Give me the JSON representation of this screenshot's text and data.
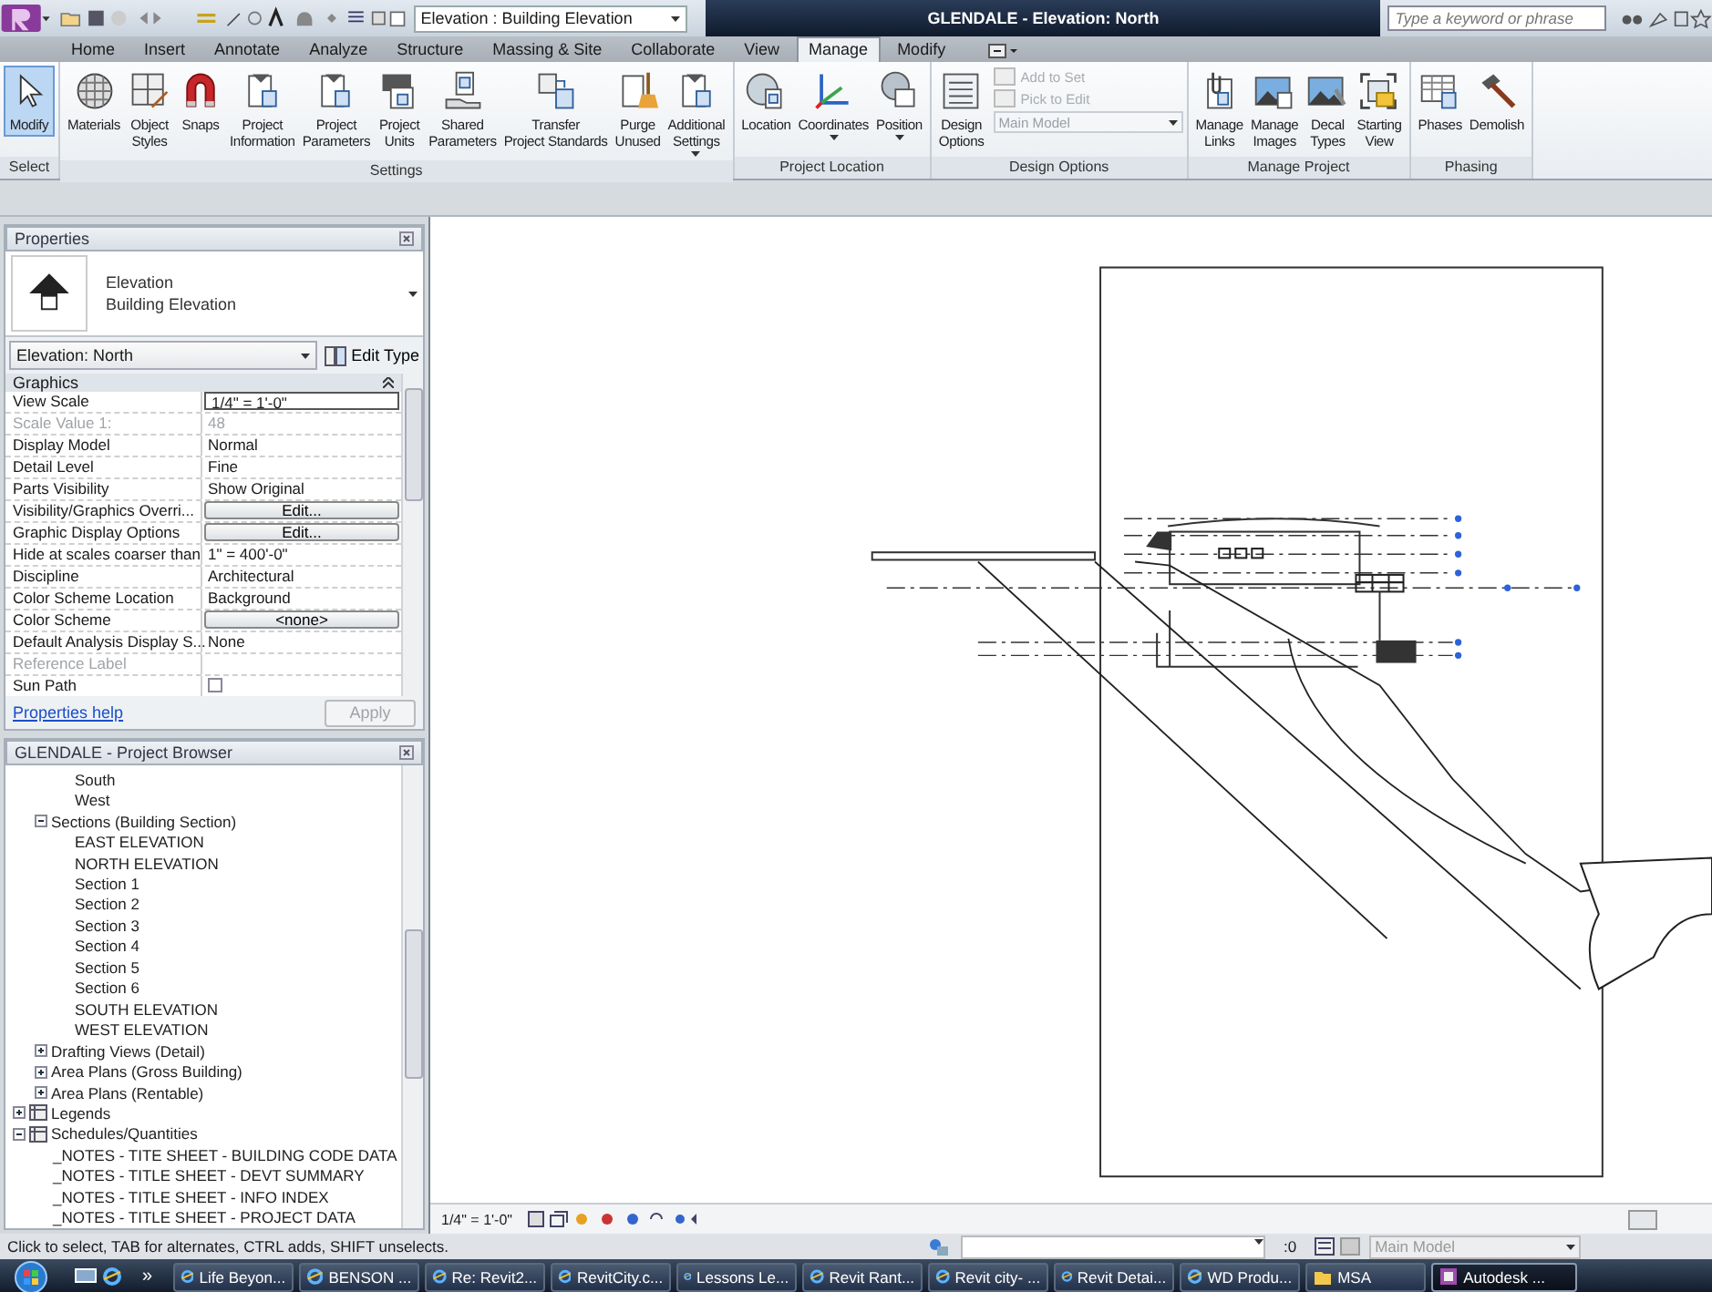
{
  "title_bar": {
    "view_selector": "Elevation : Building Elevation",
    "title": "GLENDALE - Elevation: North",
    "search": {
      "placeholder": "Type a keyword or phrase"
    }
  },
  "tabs": [
    {
      "label": "Home",
      "selected": false
    },
    {
      "label": "Insert",
      "selected": false
    },
    {
      "label": "Annotate",
      "selected": false
    },
    {
      "label": "Analyze",
      "selected": false
    },
    {
      "label": "Structure",
      "selected": false
    },
    {
      "label": "Massing & Site",
      "selected": false
    },
    {
      "label": "Collaborate",
      "selected": false
    },
    {
      "label": "View",
      "selected": false
    },
    {
      "label": "Manage",
      "selected": true
    },
    {
      "label": "Modify",
      "selected": false
    }
  ],
  "ribbon": {
    "panels": [
      {
        "title": "Select",
        "buttons": [
          {
            "kind": "cursor",
            "label": "Modify",
            "selected": true,
            "dropdown": false
          }
        ]
      },
      {
        "title": "Settings",
        "buttons": [
          {
            "kind": "sphere",
            "label": "Materials",
            "selected": false,
            "dropdown": false
          },
          {
            "kind": "styles",
            "label": "Object\nStyles",
            "selected": false,
            "dropdown": false
          },
          {
            "kind": "magnet",
            "label": "Snaps",
            "selected": false,
            "dropdown": false
          },
          {
            "kind": "doc",
            "label": "Project\nInformation",
            "selected": false,
            "dropdown": false
          },
          {
            "kind": "doc",
            "label": "Project\nParameters",
            "selected": false,
            "dropdown": false
          },
          {
            "kind": "units",
            "label": "Project\nUnits",
            "selected": false,
            "dropdown": false
          },
          {
            "kind": "shared",
            "label": "Shared\nParameters",
            "selected": false,
            "dropdown": false
          },
          {
            "kind": "transfer",
            "label": "Transfer\nProject Standards",
            "selected": false,
            "dropdown": false
          },
          {
            "kind": "purge",
            "label": "Purge\nUnused",
            "selected": false,
            "dropdown": false
          },
          {
            "kind": "doc",
            "label": "Additional\nSettings",
            "selected": false,
            "dropdown": true
          }
        ]
      },
      {
        "title": "Project Location",
        "buttons": [
          {
            "kind": "globe",
            "label": "Location",
            "selected": false,
            "dropdown": false
          },
          {
            "kind": "axes",
            "label": "Coordinates",
            "selected": false,
            "dropdown": true
          },
          {
            "kind": "position",
            "label": "Position",
            "selected": false,
            "dropdown": true
          }
        ]
      },
      {
        "title": "Design Options",
        "buttons": [
          {
            "kind": "list",
            "label": "Design\nOptions",
            "selected": false,
            "dropdown": false
          }
        ],
        "tools": [
          {
            "label": "Add to Set",
            "disabled": true
          },
          {
            "label": "Pick to Edit",
            "disabled": true
          }
        ],
        "selector": {
          "value": "Main Model",
          "disabled": true
        }
      },
      {
        "title": "Manage Project",
        "buttons": [
          {
            "kind": "links",
            "label": "Manage\nLinks",
            "selected": false,
            "dropdown": false
          },
          {
            "kind": "image",
            "label": "Manage\nImages",
            "selected": false,
            "dropdown": false
          },
          {
            "kind": "decal",
            "label": "Decal\nTypes",
            "selected": false,
            "dropdown": false
          },
          {
            "kind": "view",
            "label": "Starting\nView",
            "selected": false,
            "dropdown": false
          }
        ]
      },
      {
        "title": "Phasing",
        "buttons": [
          {
            "kind": "table",
            "label": "Phases",
            "selected": false,
            "dropdown": false
          },
          {
            "kind": "hammer",
            "label": "Demolish",
            "selected": false,
            "dropdown": false
          }
        ]
      }
    ]
  },
  "properties": {
    "title": "Properties",
    "type_name": "Elevation",
    "type_family": "Building Elevation",
    "instance_selector": "Elevation: North",
    "edit_type": "Edit Type",
    "group": "Graphics",
    "rows": [
      {
        "name": "View Scale",
        "value": "1/4\" = 1'-0\"",
        "kind": "field",
        "disabled": false
      },
      {
        "name": "Scale Value    1:",
        "value": "48",
        "kind": "text",
        "disabled": true
      },
      {
        "name": "Display Model",
        "value": "Normal",
        "kind": "text",
        "disabled": false
      },
      {
        "name": "Detail Level",
        "value": "Fine",
        "kind": "text",
        "disabled": false
      },
      {
        "name": "Parts Visibility",
        "value": "Show Original",
        "kind": "text",
        "disabled": false
      },
      {
        "name": "Visibility/Graphics Overri...",
        "value": "Edit...",
        "kind": "button",
        "disabled": false
      },
      {
        "name": "Graphic Display Options",
        "value": "Edit...",
        "kind": "button",
        "disabled": false
      },
      {
        "name": "Hide at scales coarser than",
        "value": "1\" = 400'-0\"",
        "kind": "text",
        "disabled": false
      },
      {
        "name": "Discipline",
        "value": "Architectural",
        "kind": "text",
        "disabled": false
      },
      {
        "name": "Color Scheme Location",
        "value": "Background",
        "kind": "text",
        "disabled": false
      },
      {
        "name": "Color Scheme",
        "value": "<none>",
        "kind": "button",
        "disabled": false
      },
      {
        "name": "Default Analysis Display S...",
        "value": "None",
        "kind": "text",
        "disabled": false
      },
      {
        "name": "Reference Label",
        "value": "",
        "kind": "text",
        "disabled": true
      },
      {
        "name": "Sun Path",
        "value": "",
        "kind": "checkbox",
        "disabled": false
      }
    ],
    "help_link": "Properties help",
    "apply": "Apply"
  },
  "browser": {
    "title": "GLENDALE - Project Browser",
    "tree": [
      {
        "children": [
          {
            "children": [
              {
                "label": "South"
              },
              {
                "label": "West"
              }
            ]
          },
          {
            "label": "Sections (Building Section)",
            "expanded": true,
            "children": [
              {
                "label": "EAST ELEVATION"
              },
              {
                "label": "NORTH ELEVATION"
              },
              {
                "label": "Section 1"
              },
              {
                "label": "Section 2"
              },
              {
                "label": "Section 3"
              },
              {
                "label": "Section 4"
              },
              {
                "label": "Section 5"
              },
              {
                "label": "Section 6"
              },
              {
                "label": "SOUTH ELEVATION"
              },
              {
                "label": "WEST ELEVATION"
              }
            ]
          },
          {
            "label": "Drafting Views (Detail)",
            "expanded": false
          },
          {
            "label": "Area Plans (Gross Building)",
            "expanded": false
          },
          {
            "label": "Area Plans (Rentable)",
            "expanded": false
          }
        ]
      },
      {
        "label": "Legends",
        "expanded": false,
        "kind": "category"
      },
      {
        "label": "Schedules/Quantities",
        "expanded": true,
        "kind": "category",
        "children": [
          {
            "label": "_NOTES - TITE SHEET - BUILDING CODE DATA"
          },
          {
            "label": "_NOTES - TITLE SHEET - DEVT SUMMARY"
          },
          {
            "label": "_NOTES - TITLE SHEET - INFO INDEX"
          },
          {
            "label": "_NOTES - TITLE SHEET - PROJECT DATA"
          }
        ]
      }
    ]
  },
  "view_bar": {
    "scale": "1/4\" = 1'-0\""
  },
  "status_bar": {
    "message": "Click to select, TAB for alternates, CTRL adds, SHIFT unselects.",
    "selection_count": ":0",
    "design_option": {
      "value": "Main Model",
      "disabled": true
    }
  },
  "taskbar": {
    "overflow": "»",
    "tasks": [
      {
        "label": "Life Beyon...",
        "kind": "browser",
        "selected": false
      },
      {
        "label": "BENSON ...",
        "kind": "browser",
        "selected": false
      },
      {
        "label": "Re: Revit2...",
        "kind": "browser",
        "selected": false
      },
      {
        "label": "RevitCity.c...",
        "kind": "browser",
        "selected": false
      },
      {
        "label": "Lessons Le...",
        "kind": "browser",
        "selected": false
      },
      {
        "label": "Revit Rant...",
        "kind": "browser",
        "selected": false
      },
      {
        "label": "Revit city- ...",
        "kind": "browser",
        "selected": false
      },
      {
        "label": "Revit Detai...",
        "kind": "browser",
        "selected": false
      },
      {
        "label": "WD Produ...",
        "kind": "browser",
        "selected": false
      },
      {
        "label": "MSA",
        "kind": "folder",
        "selected": false
      },
      {
        "label": "Autodesk ...",
        "kind": "app",
        "selected": true
      }
    ]
  }
}
